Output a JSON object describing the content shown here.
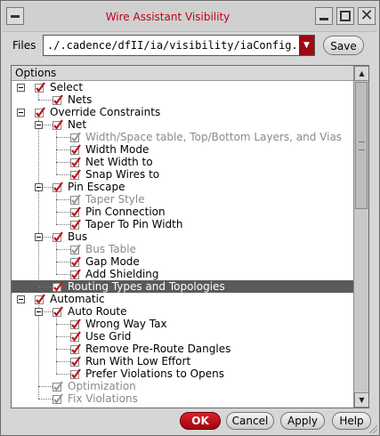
{
  "window": {
    "title": "Wire Assistant Visibility"
  },
  "files": {
    "label": "Files",
    "value": "./.cadence/dfII/ia/visibility/iaConfig.il",
    "save_label": "Save"
  },
  "options": {
    "header": "Options",
    "rows": [
      {
        "label": "Select",
        "level": 0,
        "expand": true,
        "checked": true,
        "dim": false,
        "selected": false
      },
      {
        "label": "Nets",
        "level": 1,
        "expand": false,
        "checked": true,
        "dim": false,
        "selected": false
      },
      {
        "label": "Override Constraints",
        "level": 0,
        "expand": true,
        "checked": true,
        "dim": false,
        "selected": false
      },
      {
        "label": "Net",
        "level": 1,
        "expand": true,
        "checked": true,
        "dim": false,
        "selected": false
      },
      {
        "label": "Width/Space table, Top/Bottom Layers, and Vias",
        "level": 2,
        "expand": false,
        "checked": true,
        "dim": true,
        "selected": false
      },
      {
        "label": "Width Mode",
        "level": 2,
        "expand": false,
        "checked": true,
        "dim": false,
        "selected": false
      },
      {
        "label": "Net Width to",
        "level": 2,
        "expand": false,
        "checked": true,
        "dim": false,
        "selected": false
      },
      {
        "label": "Snap Wires to",
        "level": 2,
        "expand": false,
        "checked": true,
        "dim": false,
        "selected": false
      },
      {
        "label": "Pin Escape",
        "level": 1,
        "expand": true,
        "checked": true,
        "dim": false,
        "selected": false
      },
      {
        "label": "Taper Style",
        "level": 2,
        "expand": false,
        "checked": true,
        "dim": true,
        "selected": false
      },
      {
        "label": "Pin Connection",
        "level": 2,
        "expand": false,
        "checked": true,
        "dim": false,
        "selected": false
      },
      {
        "label": "Taper To Pin Width",
        "level": 2,
        "expand": false,
        "checked": true,
        "dim": false,
        "selected": false
      },
      {
        "label": "Bus",
        "level": 1,
        "expand": true,
        "checked": true,
        "dim": false,
        "selected": false
      },
      {
        "label": "Bus Table",
        "level": 2,
        "expand": false,
        "checked": true,
        "dim": true,
        "selected": false
      },
      {
        "label": "Gap Mode",
        "level": 2,
        "expand": false,
        "checked": true,
        "dim": false,
        "selected": false
      },
      {
        "label": "Add Shielding",
        "level": 2,
        "expand": false,
        "checked": true,
        "dim": false,
        "selected": false
      },
      {
        "label": "Routing Types and Topologies",
        "level": 1,
        "expand": false,
        "checked": true,
        "dim": false,
        "selected": true
      },
      {
        "label": "Automatic",
        "level": 0,
        "expand": true,
        "checked": true,
        "dim": false,
        "selected": false
      },
      {
        "label": "Auto Route",
        "level": 1,
        "expand": true,
        "checked": true,
        "dim": false,
        "selected": false
      },
      {
        "label": "Wrong Way Tax",
        "level": 2,
        "expand": false,
        "checked": true,
        "dim": false,
        "selected": false
      },
      {
        "label": "Use Grid",
        "level": 2,
        "expand": false,
        "checked": true,
        "dim": false,
        "selected": false
      },
      {
        "label": "Remove Pre-Route Dangles",
        "level": 2,
        "expand": false,
        "checked": true,
        "dim": false,
        "selected": false
      },
      {
        "label": "Run With Low Effort",
        "level": 2,
        "expand": false,
        "checked": true,
        "dim": false,
        "selected": false
      },
      {
        "label": "Prefer Violations to Opens",
        "level": 2,
        "expand": false,
        "checked": true,
        "dim": false,
        "selected": false
      },
      {
        "label": "Optimization",
        "level": 1,
        "expand": false,
        "checked": true,
        "dim": true,
        "selected": false
      },
      {
        "label": "Fix Violations",
        "level": 1,
        "expand": false,
        "checked": true,
        "dim": true,
        "selected": false
      }
    ]
  },
  "buttons": {
    "ok": "OK",
    "cancel": "Cancel",
    "apply": "Apply",
    "help": "Help"
  },
  "colors": {
    "check_active": "#c0101a",
    "check_dim": "#9a9a9a",
    "title": "#c0001a",
    "ok_button": "#b00d18"
  }
}
